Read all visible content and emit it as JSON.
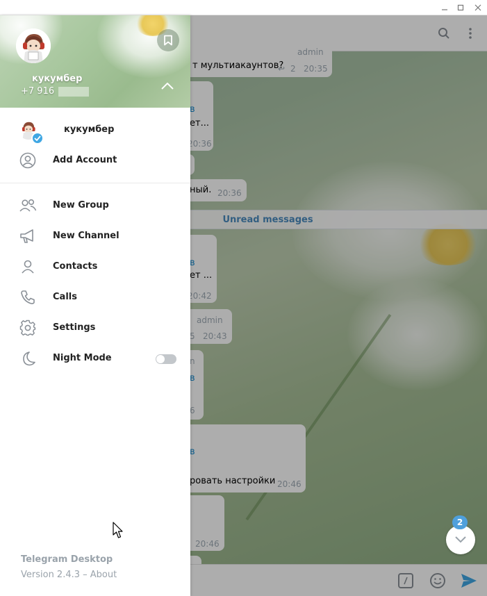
{
  "window": {
    "controls": [
      "minimize-icon",
      "maximize-icon",
      "close-icon"
    ]
  },
  "chat": {
    "unread_label": "Unread messages",
    "messages": [
      {
        "sender": "admin",
        "text": "т мультиакаунтов?",
        "replies": "2",
        "time": "20:35"
      },
      {
        "link": "в",
        "text": "ет...",
        "time": "20:36"
      },
      {
        "text": "ный.",
        "time": "20:36"
      },
      {
        "link": "в",
        "text": "ет ...",
        "time": "20:42"
      },
      {
        "sender": "admin",
        "replies": "5",
        "time": "20:43"
      },
      {
        "sender": "n",
        "link": "в",
        "time": "6"
      },
      {
        "link": "в",
        "text": "ровать настройки",
        "time": "20:46"
      },
      {
        "time": "20:46"
      }
    ],
    "scroll_badge": "2"
  },
  "drawer": {
    "profile_name": "кукумбер",
    "phone": "+7 916",
    "accounts": [
      {
        "name": "кукумбер",
        "active": true
      }
    ],
    "add_account_label": "Add Account",
    "menu": [
      {
        "id": "new-group",
        "label": "New Group",
        "icon": "group-icon"
      },
      {
        "id": "new-channel",
        "label": "New Channel",
        "icon": "megaphone-icon"
      },
      {
        "id": "contacts",
        "label": "Contacts",
        "icon": "person-icon"
      },
      {
        "id": "calls",
        "label": "Calls",
        "icon": "phone-icon"
      },
      {
        "id": "settings",
        "label": "Settings",
        "icon": "gear-icon"
      },
      {
        "id": "night-mode",
        "label": "Night Mode",
        "icon": "moon-icon",
        "toggle": false
      }
    ],
    "footer": {
      "app_name": "Telegram Desktop",
      "version": "Version 2.4.3",
      "separator": " – ",
      "about": "About"
    }
  },
  "colors": {
    "accent": "#40a7e3",
    "link": "#168acd",
    "unread": "#4b8bbe",
    "muted": "#9aa3ab"
  }
}
